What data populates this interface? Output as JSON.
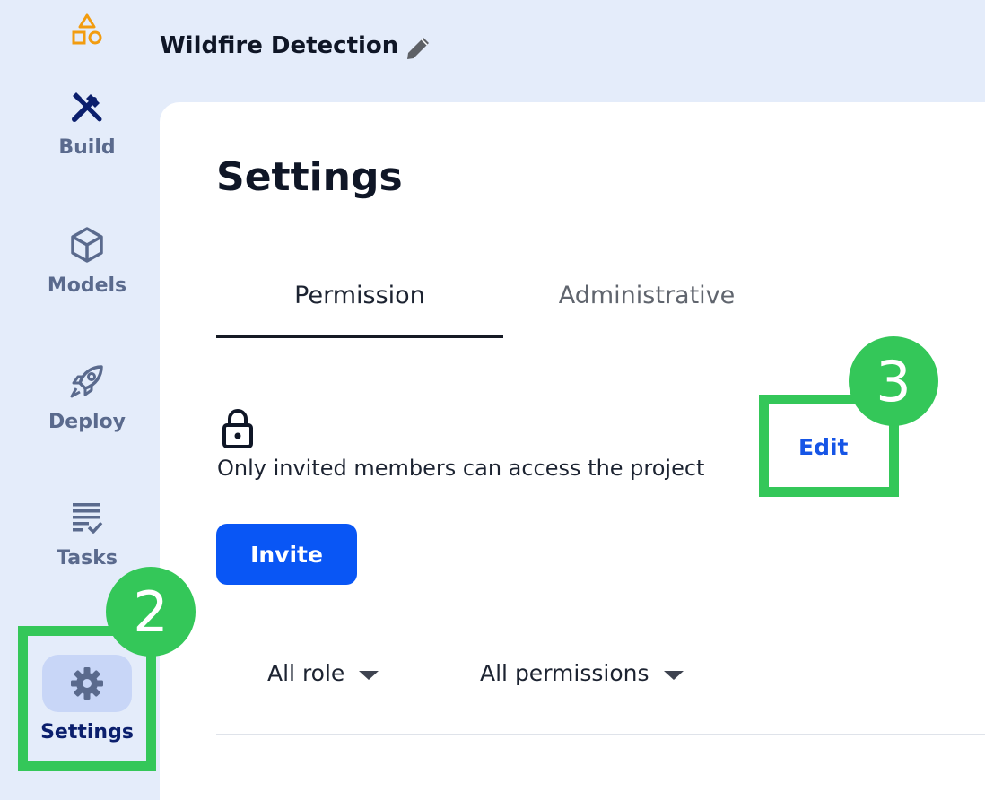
{
  "app": {
    "project_title": "Wildfire Detection"
  },
  "sidebar": {
    "items": [
      {
        "label": "Build",
        "icon": "tools-icon"
      },
      {
        "label": "Models",
        "icon": "cube-icon"
      },
      {
        "label": "Deploy",
        "icon": "rocket-icon"
      },
      {
        "label": "Tasks",
        "icon": "task-list-icon"
      },
      {
        "label": "Settings",
        "icon": "gear-icon",
        "active": true
      }
    ]
  },
  "main": {
    "title": "Settings",
    "tabs": [
      {
        "label": "Permission",
        "active": true
      },
      {
        "label": "Administrative",
        "active": false
      }
    ],
    "access": {
      "icon": "lock-icon",
      "text": "Only invited members can access the project",
      "edit_label": "Edit"
    },
    "invite_label": "Invite",
    "filters": {
      "role": "All role",
      "permissions": "All permissions"
    }
  },
  "annotations": {
    "badge_settings": "2",
    "badge_edit": "3"
  },
  "colors": {
    "accent": "#0956f5",
    "highlight": "#34c759",
    "sidebar_bg": "#e4ecfa",
    "nav_icon": "#5a6a8d",
    "nav_active": "#0b1f6d",
    "logo": "#f29c0f"
  }
}
